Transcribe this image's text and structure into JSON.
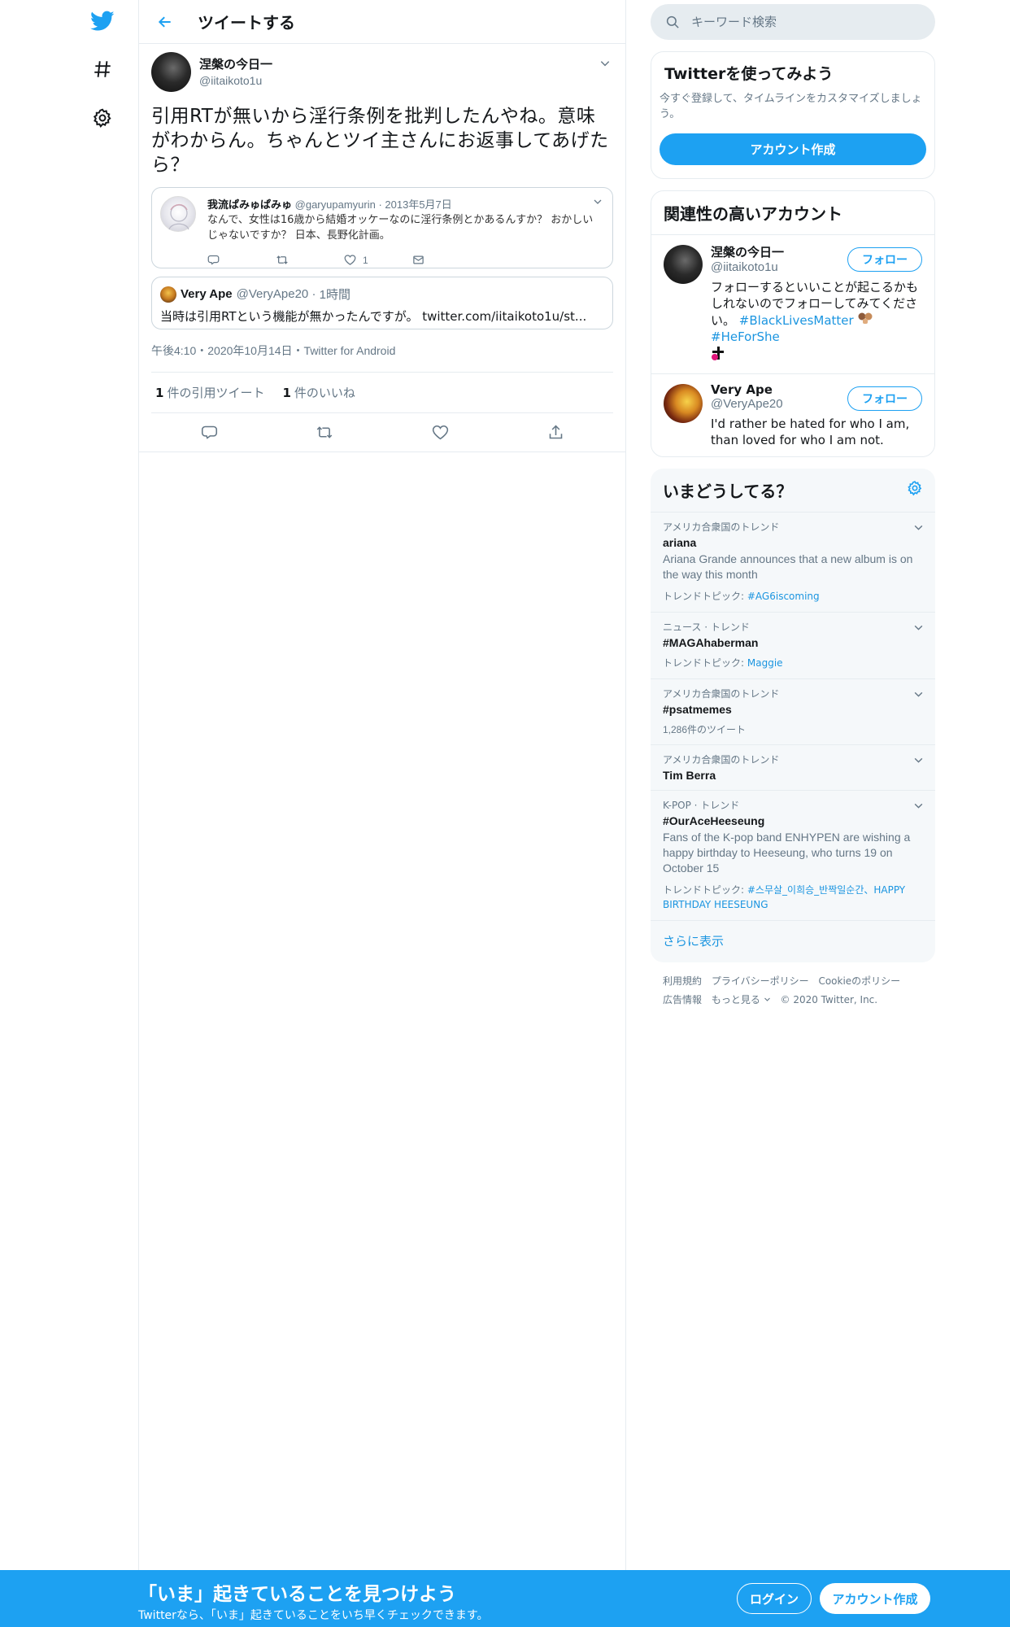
{
  "nav": {
    "icons": [
      "twitter-logo-icon",
      "hashtag-icon",
      "gear-icon"
    ]
  },
  "header": {
    "title": "ツイートする"
  },
  "tweet": {
    "author_name": "涅槃の今日一",
    "author_handle": "@iitaikoto1u",
    "text": "引用RTが無いから淫行条例を批判したんやね。意味がわからん。ちゃんとツイ主さんにお返事してあげたら？",
    "quoted": {
      "name": "我流ぱみゅぱみゅ",
      "handle": "@garyupamyurin",
      "date": "2013年5月7日",
      "text": "なんで、女性は16歳から結婚オッケーなのに淫行条例とかあるんすか？ おかしいじゃないですか？ 日本、長野化計画。",
      "like_count": "1"
    },
    "reply_quote": {
      "name": "Very Ape",
      "handle": "@VeryApe20",
      "time": "1時間",
      "text": "当時は引用RTという機能が無かったんですが。 twitter.com/iitaikoto1u/st..."
    },
    "meta": "午後4:10・2020年10月14日・Twitter for Android",
    "quote_count": "1",
    "quote_label": "件の引用ツイート",
    "like_count": "1",
    "like_label": "件のいいね"
  },
  "search": {
    "placeholder": "キーワード検索"
  },
  "signup_panel": {
    "title": "Twitterを使ってみよう",
    "desc": "今すぐ登録して、タイムラインをカスタマイズしましょう。",
    "button": "アカウント作成"
  },
  "related": {
    "title": "関連性の高いアカウント",
    "accounts": [
      {
        "name": "涅槃の今日一",
        "handle": "@iitaikoto1u",
        "bio": "フォローするといいことが起こるかもしれないのでフォローしてみてください。",
        "tag1": "#BlackLivesMatter",
        "tag2": "#HeForShe",
        "follow": "フォロー"
      },
      {
        "name": "Very Ape",
        "handle": "@VeryApe20",
        "bio": "I'd rather be hated for who I am, than loved for who I am not.",
        "follow": "フォロー"
      }
    ]
  },
  "trends": {
    "title": "いまどうしてる？",
    "items": [
      {
        "category": "アメリカ合衆国のトレンド",
        "name": "ariana",
        "desc": "Ariana Grande announces that a new album is on the way this month",
        "topic_label": "トレンドトピック:",
        "topic_links": "#AG6iscoming"
      },
      {
        "category": "ニュース · トレンド",
        "name": "#MAGAhaberman",
        "topic_label": "トレンドトピック:",
        "topic_links": "Maggie"
      },
      {
        "category": "アメリカ合衆国のトレンド",
        "name": "#psatmemes",
        "count": "1,286件のツイート"
      },
      {
        "category": "アメリカ合衆国のトレンド",
        "name": "Tim Berra"
      },
      {
        "category": "K-POP · トレンド",
        "name": "#OurAceHeeseung",
        "desc": "Fans of the K-pop band ENHYPEN are wishing a happy birthday to Heeseung, who turns 19 on October 15",
        "topic_label": "トレンドトピック:",
        "topic_links": "#스무살_이희승_반짝일순간、HAPPY BIRTHDAY HEESEUNG"
      }
    ],
    "show_more": "さらに表示"
  },
  "footer": {
    "links": [
      "利用規約",
      "プライバシーポリシー",
      "Cookieのポリシー",
      "広告情報",
      "もっと見る"
    ],
    "copyright": "© 2020 Twitter, Inc."
  },
  "bottom_bar": {
    "title": "「いま」起きていることを見つけよう",
    "subtitle": "Twitterなら、「いま」起きていることをいち早くチェックできます。",
    "login": "ログイン",
    "signup": "アカウント作成"
  },
  "colors": {
    "brand": "#1da1f2",
    "link": "#1b95e0",
    "muted": "#657786",
    "border": "#e6ecf0"
  }
}
